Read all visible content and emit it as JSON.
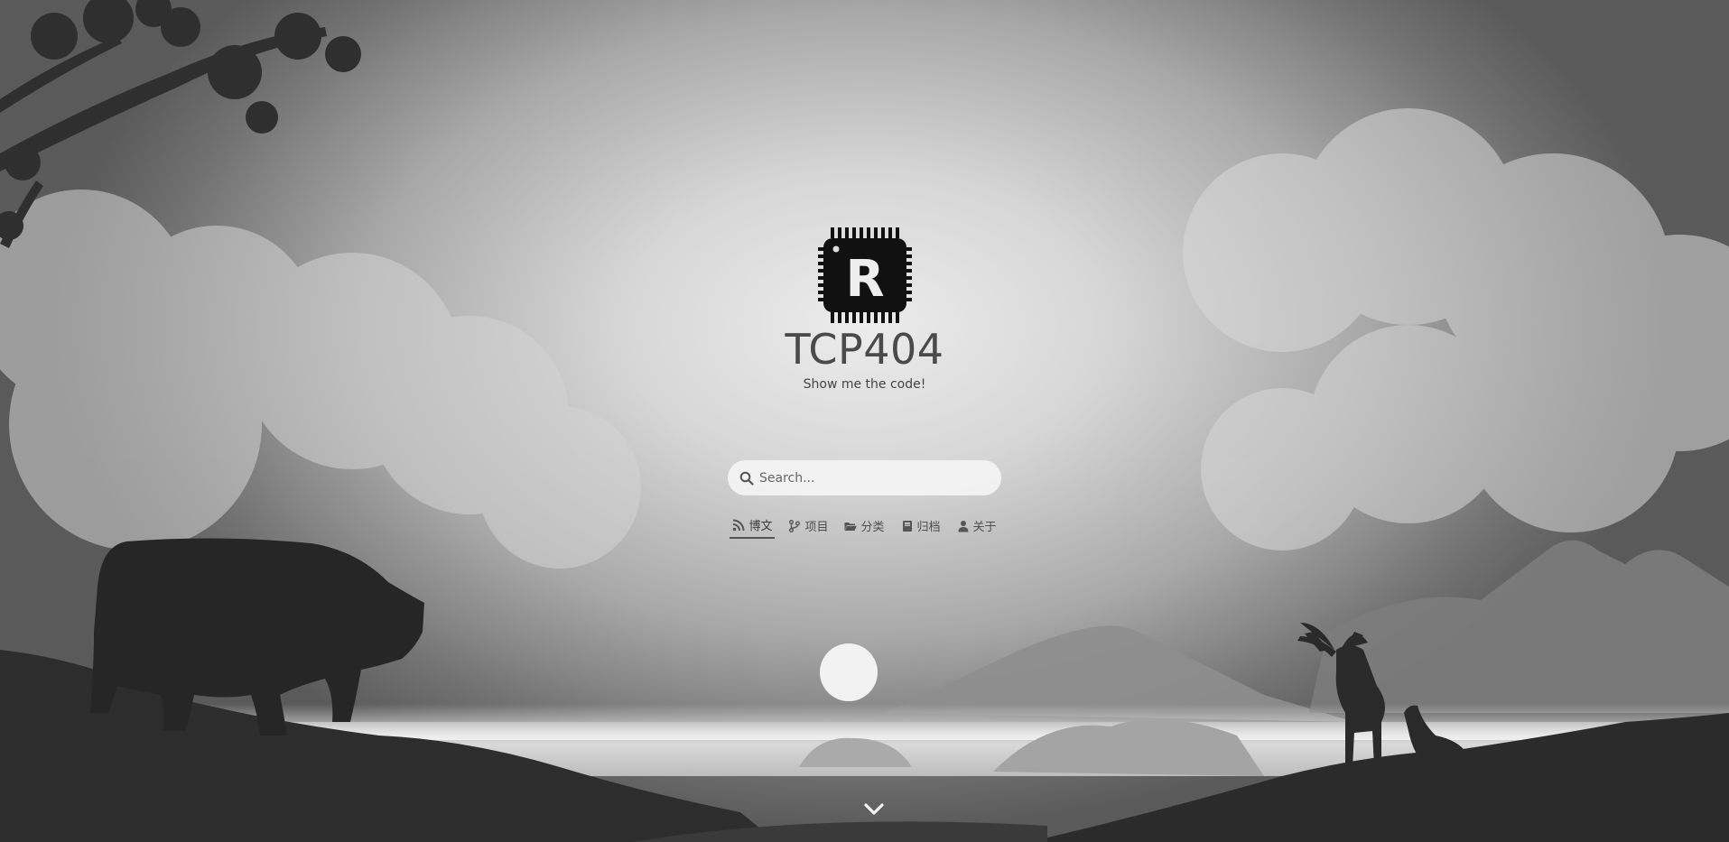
{
  "site": {
    "title": "TCP404",
    "subtitle": "Show me the code!",
    "logo_letter": "R"
  },
  "search": {
    "placeholder": "Search..."
  },
  "nav": {
    "items": [
      {
        "label": "博文",
        "icon": "rss-icon",
        "active": true
      },
      {
        "label": "项目",
        "icon": "code-branch-icon",
        "active": false
      },
      {
        "label": "分类",
        "icon": "folder-open-icon",
        "active": false
      },
      {
        "label": "归档",
        "icon": "book-icon",
        "active": false
      },
      {
        "label": "关于",
        "icon": "user-icon",
        "active": false
      }
    ]
  },
  "scroll": {
    "icon": "chevron-down-icon"
  },
  "colors": {
    "sky_center": "#ececec",
    "sky_edge": "#5a5a5a",
    "silhouette": "#2a2a2a",
    "text": "#4a4a4a"
  }
}
